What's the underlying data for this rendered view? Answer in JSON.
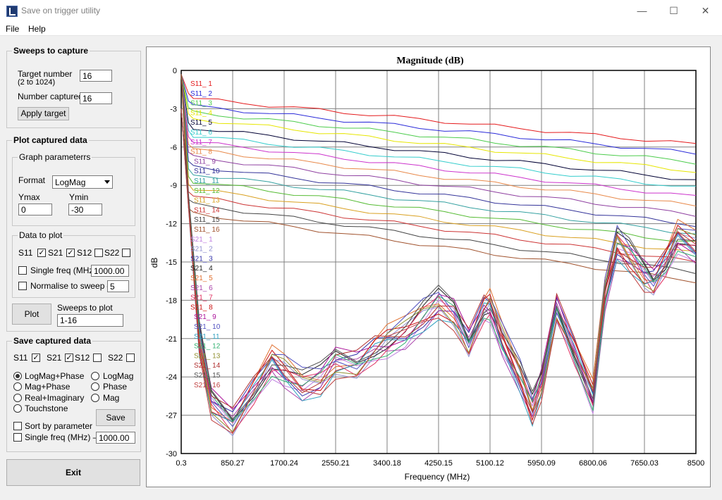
{
  "window": {
    "title": "Save on trigger utility",
    "minimize": "—",
    "maximize": "☐",
    "close": "✕"
  },
  "menu": {
    "file": "File",
    "help": "Help"
  },
  "sweeps": {
    "title": "Sweeps to capture",
    "target_label_1": "Target number",
    "target_label_2": "(2 to 1024)",
    "target_value": "16",
    "captured_label": "Number captured",
    "captured_value": "16",
    "apply_label": "Apply target"
  },
  "plot_section": {
    "title": "Plot captured data",
    "graph_params_title": "Graph parameterrs",
    "format_label": "Format",
    "format_value": "LogMag",
    "ymax_label": "Ymax",
    "ymin_label": "Ymin",
    "ymax_value": "0",
    "ymin_value": "-30",
    "data_title": "Data  to plot",
    "s11": "S11",
    "s21": "S21",
    "s12": "S12",
    "s22": "S22",
    "single_freq_label": "Single freq (MHz)",
    "single_freq_value": "1000.00",
    "normalise_label": "Normalise to sweep –",
    "normalise_value": "5",
    "plot_button": "Plot",
    "sweeps_label": "Sweeps to plot",
    "sweeps_value": "1-16"
  },
  "save_section": {
    "title": "Save captured data",
    "s11": "S11",
    "s21": "S21",
    "s12": "S12",
    "s22": "S22",
    "opt_logmag_phase": "LogMag+Phase",
    "opt_logmag": "LogMag",
    "opt_mag_phase": "Mag+Phase",
    "opt_phase": "Phase",
    "opt_real_imag": "Real+Imaginary",
    "opt_mag": "Mag",
    "opt_touchstone": "Touchstone",
    "save_button": "Save",
    "sort_label": "Sort by parameter",
    "single_freq_label": "Single freq (MHz) –",
    "single_freq_value": "1000.00"
  },
  "exit_label": "Exit",
  "chart_data": {
    "type": "line",
    "title": "Magnitude (dB)",
    "xlabel": "Frequency (MHz)",
    "ylabel": "dB",
    "x_ticks": [
      "0.3",
      "850.27",
      "1700.24",
      "2550.21",
      "3400.18",
      "4250.15",
      "5100.12",
      "5950.09",
      "6800.06",
      "7650.03",
      "8500"
    ],
    "y_ticks": [
      "0",
      "-3",
      "-6",
      "-9",
      "-12",
      "-15",
      "-18",
      "-21",
      "-24",
      "-27",
      "-30"
    ],
    "xlim": [
      0.3,
      8500
    ],
    "ylim": [
      -30,
      0
    ],
    "grid": true,
    "legend_position": "top-left inside",
    "legend": [
      "S11_ 1",
      "S11_ 2",
      "S11_ 3",
      "S11_ 4",
      "S11_ 5",
      "S11_ 6",
      "S11_ 7",
      "S11_ 8",
      "S11_ 9",
      "S11_ 10",
      "S11_ 11",
      "S11_ 12",
      "S11_ 13",
      "S11_ 14",
      "S11_ 15",
      "S11_ 16",
      "S21_ 1",
      "S21_ 2",
      "S21_ 3",
      "S21_ 4",
      "S21_ 5",
      "S21_ 6",
      "S21_ 7",
      "S21_ 8",
      "S21_ 9",
      "S21_ 10",
      "S21_ 11",
      "S21_ 12",
      "S21_ 13",
      "S21_ 14",
      "S21_ 15",
      "S21_ 16"
    ],
    "colors": [
      "#e41a1c",
      "#2b2bd9",
      "#4ccc4c",
      "#e6e600",
      "#000033",
      "#33cccc",
      "#cc33cc",
      "#e8894a",
      "#8e3fa0",
      "#333399",
      "#33a0a0",
      "#55bb33",
      "#d9a020",
      "#cc3333",
      "#444444",
      "#a0522d",
      "#c080e0",
      "#9090d0",
      "#3333aa",
      "#222222",
      "#e07030",
      "#aa44aa",
      "#e03060",
      "#cc1111",
      "#aa1199",
      "#5050c0",
      "#30a0c0",
      "#30b070",
      "#909030",
      "#b03030",
      "#505050",
      "#c04040"
    ],
    "s11_start_values": [
      -2.2,
      -2.8,
      -3.3,
      -3.8,
      -4.5,
      -5.1,
      -5.6,
      -6.2,
      -6.8,
      -7.5,
      -8.1,
      -8.7,
      -9.3,
      -9.9,
      -10.5,
      -11.2
    ],
    "s11_end_values": [
      -5.8,
      -6.5,
      -7.2,
      -7.9,
      -8.6,
      -9.2,
      -9.9,
      -10.6,
      -11.3,
      -12.1,
      -12.8,
      -13.5,
      -14.3,
      -15.0,
      -15.8,
      -16.5
    ],
    "s21_x": [
      0.3,
      300,
      500,
      850,
      1200,
      1500,
      1700,
      2000,
      2300,
      2550,
      2900,
      3200,
      3400,
      3700,
      4000,
      4250,
      4500,
      4750,
      5000,
      5100,
      5300,
      5600,
      5800,
      5950,
      6200,
      6500,
      6800,
      7000,
      7200,
      7400,
      7650,
      7800,
      8000,
      8200,
      8500
    ],
    "s21_y": [
      -3,
      -21,
      -26,
      -27.5,
      -25,
      -22.8,
      -23.5,
      -24.6,
      -24.2,
      -22.8,
      -23,
      -21.8,
      -21.2,
      -20.5,
      -19.2,
      -18.2,
      -19,
      -21.3,
      -18.6,
      -18.4,
      -21,
      -24,
      -26.5,
      -24.5,
      -18.6,
      -22,
      -25.5,
      -17.5,
      -13.5,
      -14.5,
      -16,
      -16.5,
      -15,
      -13,
      -13.8
    ]
  }
}
